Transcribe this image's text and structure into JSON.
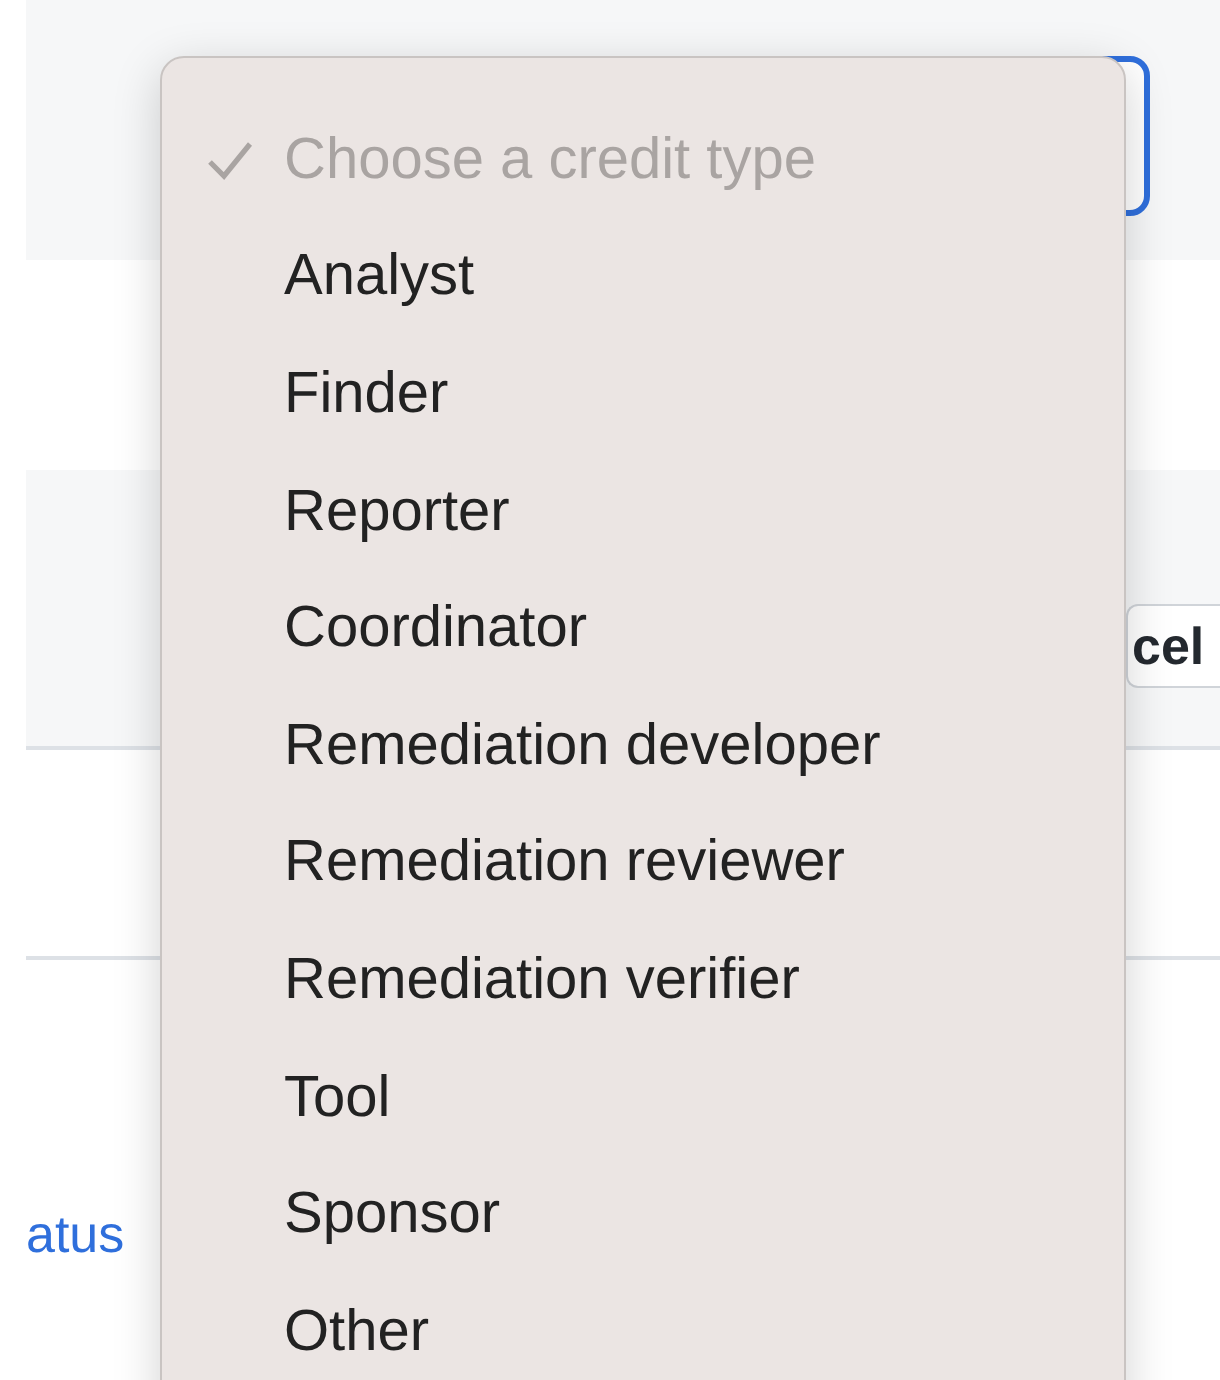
{
  "cancel_button": {
    "label": "cel"
  },
  "status_link": {
    "label": "atus"
  },
  "credit_type_menu": {
    "options": [
      {
        "label": "Choose a credit type",
        "selected": true,
        "disabled": true
      },
      {
        "label": "Analyst",
        "selected": false,
        "disabled": false
      },
      {
        "label": "Finder",
        "selected": false,
        "disabled": false
      },
      {
        "label": "Reporter",
        "selected": false,
        "disabled": false
      },
      {
        "label": "Coordinator",
        "selected": false,
        "disabled": false
      },
      {
        "label": "Remediation developer",
        "selected": false,
        "disabled": false
      },
      {
        "label": "Remediation reviewer",
        "selected": false,
        "disabled": false
      },
      {
        "label": "Remediation verifier",
        "selected": false,
        "disabled": false
      },
      {
        "label": "Tool",
        "selected": false,
        "disabled": false
      },
      {
        "label": "Sponsor",
        "selected": false,
        "disabled": false
      },
      {
        "label": "Other",
        "selected": false,
        "disabled": false
      }
    ]
  }
}
